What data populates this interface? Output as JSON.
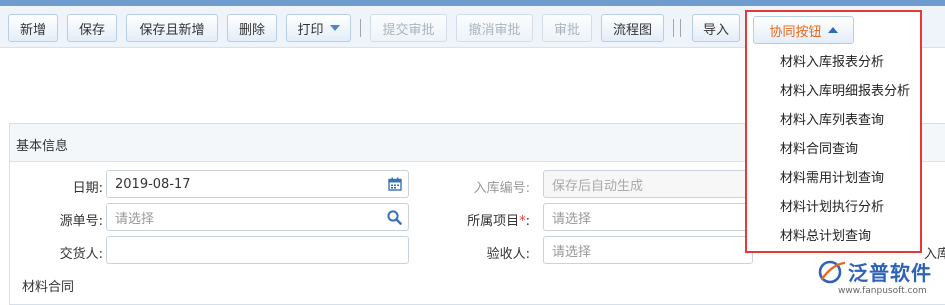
{
  "toolbar": {
    "buttons": [
      {
        "label": "新增",
        "enabled": true
      },
      {
        "label": "保存",
        "enabled": true
      },
      {
        "label": "保存且新增",
        "enabled": true
      },
      {
        "label": "删除",
        "enabled": true
      },
      {
        "label": "打印",
        "enabled": true,
        "has_dropdown": true
      },
      {
        "label": "提交审批",
        "enabled": false
      },
      {
        "label": "撤消审批",
        "enabled": false
      },
      {
        "label": "审批",
        "enabled": false
      },
      {
        "label": "流程图",
        "enabled": true
      },
      {
        "label": "导入",
        "enabled": true
      }
    ]
  },
  "cooperation_menu": {
    "button_label": "协同按钮",
    "items": [
      "材料入库报表分析",
      "材料入库明细报表分析",
      "材料入库列表查询",
      "材料合同查询",
      "材料需用计划查询",
      "材料计划执行分析",
      "材料总计划查询"
    ],
    "highlight_color": "#e53935"
  },
  "form": {
    "section_title": "基本信息",
    "date_label": "日期:",
    "date_value": "2019-08-17",
    "receipt_no_label": "入库编号:",
    "receipt_no_placeholder": "保存后自动生成",
    "source_label": "源单号:",
    "source_placeholder": "请选择",
    "project_label": "所属项目",
    "project_required_mark": "*",
    "project_colon": ":",
    "project_placeholder": "请选择",
    "deliverer_label": "交货人:",
    "deliverer_value": "",
    "receiver_label": "验收人:",
    "receiver_placeholder": "请选择",
    "contract_label": "材料合同",
    "right_edge_fragments": [
      "入库"
    ]
  },
  "logo": {
    "name": "泛普软件",
    "url": "www.fanpusoft.com"
  },
  "colors": {
    "accent": "#2c63b8",
    "toolbar_bg": "#eef4fa",
    "menu_button_text": "#e8691a"
  }
}
